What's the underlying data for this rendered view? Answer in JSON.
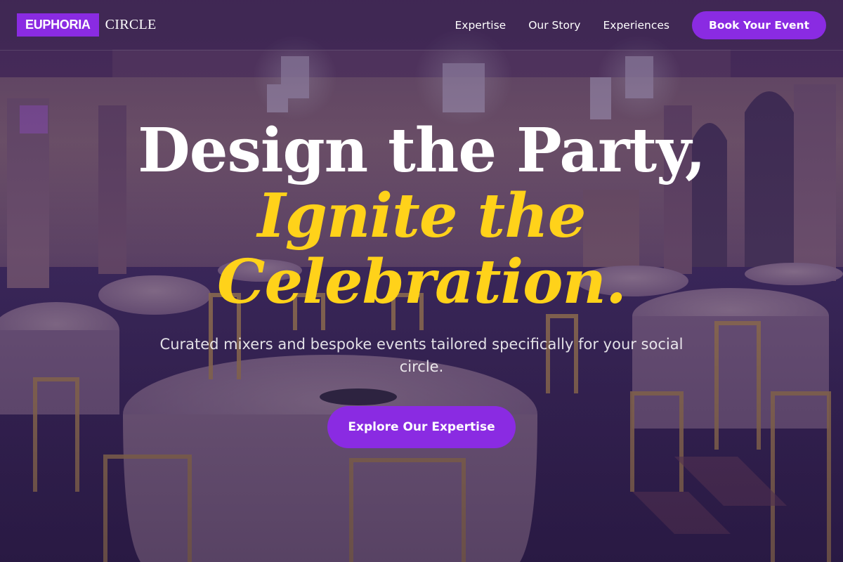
{
  "header": {
    "logo_highlight": "EUPHORIA",
    "logo_rest": "CIRCLE",
    "nav": [
      "Expertise",
      "Our Story",
      "Experiences"
    ],
    "cta_label": "Book Your Event"
  },
  "hero": {
    "line1": "Design the Party,",
    "line2": "Ignite the",
    "line3": "Celebration.",
    "subtitle": "Curated mixers and bespoke events tailored specifically for your social circle.",
    "button_label": "Explore Our Expertise"
  },
  "colors": {
    "accent": "#8a2be2",
    "highlight": "#ffd21a",
    "overlay": "#3a2250"
  }
}
